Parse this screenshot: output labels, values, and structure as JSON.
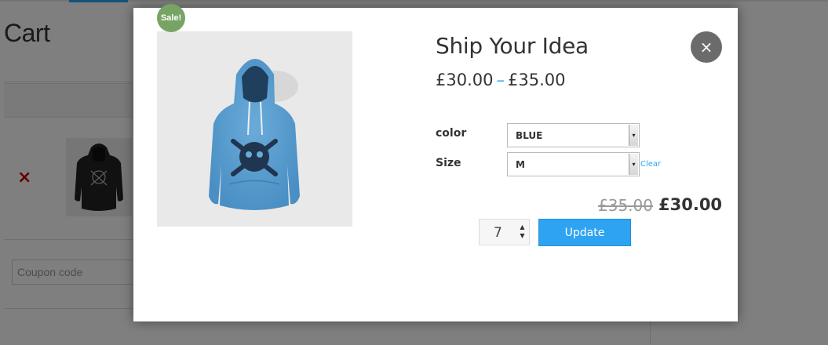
{
  "background": {
    "page_title": "Cart",
    "coupon_placeholder": "Coupon code",
    "remove_icon": "×",
    "accent": "#2ea3f2"
  },
  "modal": {
    "sale_badge": "Sale!",
    "product_title": "Ship Your Idea",
    "price_range": {
      "low": "£30.00",
      "separator": "–",
      "high": "£35.00"
    },
    "attributes": [
      {
        "label": "color",
        "selected": "BLUE"
      },
      {
        "label": "Size",
        "selected": "M"
      }
    ],
    "clear_link": "Clear",
    "price_old": "£35.00",
    "price_new": "£30.00",
    "quantity": "7",
    "update_label": "Update",
    "close_icon": "×",
    "colors": {
      "sale_badge": "#77a464",
      "button": "#2ea3f2",
      "close": "#6b6b6b",
      "hoodie": "#5a9ed1"
    }
  }
}
